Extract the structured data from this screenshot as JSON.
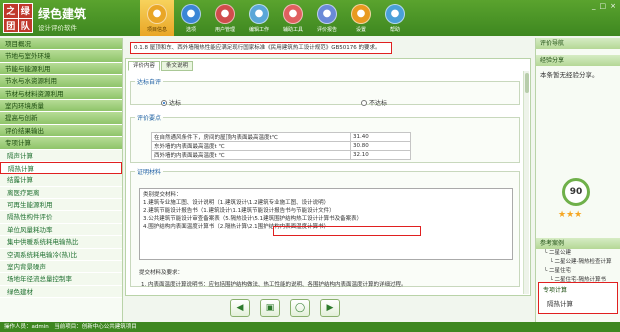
{
  "app": {
    "logo_chars": [
      "之",
      "绿",
      "团",
      "队"
    ],
    "title": "绿色建筑",
    "subtitle": "设计评价软件"
  },
  "nav": [
    {
      "label": "项目信息",
      "icon": "folder-icon",
      "color": "#e9a626",
      "active": true
    },
    {
      "label": "选项",
      "icon": "options-icon",
      "color": "#3b86d6",
      "active": false
    },
    {
      "label": "用户管理",
      "icon": "user-icon",
      "color": "#d04c4c",
      "active": false
    },
    {
      "label": "编辑工作",
      "icon": "edit-icon",
      "color": "#5ba7d8",
      "active": false
    },
    {
      "label": "辅助工具",
      "icon": "tool-icon",
      "color": "#e06060",
      "active": false
    },
    {
      "label": "评价报告",
      "icon": "report-icon",
      "color": "#6a8ad8",
      "active": false
    },
    {
      "label": "设置",
      "icon": "settings-icon",
      "color": "#e89a20",
      "active": false
    },
    {
      "label": "帮助",
      "icon": "help-icon",
      "color": "#4aa0d8",
      "active": false
    }
  ],
  "window_controls": [
    "_",
    "□",
    "×"
  ],
  "sidebar": [
    {
      "label": "项目概况",
      "type": "cat"
    },
    {
      "label": "节地与室外环境",
      "type": "cat"
    },
    {
      "label": "节能与能源利用",
      "type": "cat"
    },
    {
      "label": "节水与水资源利用",
      "type": "cat"
    },
    {
      "label": "节材与材料资源利用",
      "type": "cat"
    },
    {
      "label": "室内环境质量",
      "type": "cat"
    },
    {
      "label": "提高与创新",
      "type": "cat"
    },
    {
      "label": "评价结果输出",
      "type": "cat"
    },
    {
      "label": "专项计算",
      "type": "cat"
    },
    {
      "label": "隔声计算",
      "type": "sub"
    },
    {
      "label": "隔热计算",
      "type": "sub",
      "selected": true
    },
    {
      "label": "结露计算",
      "type": "sub"
    },
    {
      "label": "离医疗距离",
      "type": "sub"
    },
    {
      "label": "可再生能源利用",
      "type": "sub"
    },
    {
      "label": "隔热性构件评价",
      "type": "sub"
    },
    {
      "label": "单位风量耗功率",
      "type": "sub"
    },
    {
      "label": "集中供暖系统耗电输热比",
      "type": "sub"
    },
    {
      "label": "空调系统耗电输冷(热)比",
      "type": "sub"
    },
    {
      "label": "室内背景噪声",
      "type": "sub"
    },
    {
      "label": "场地年径流总量控制率",
      "type": "sub"
    },
    {
      "label": "绿色建材",
      "type": "sub"
    }
  ],
  "notice": "0.1.8 屋顶和东、西外墙隔热性能应满足现行国家标准《民用建筑热工设计规范》GB50176 的要求。",
  "tabs": [
    {
      "label": "评价内容",
      "active": true
    },
    {
      "label": "条文说明",
      "active": false
    }
  ],
  "compliance": {
    "legend": "达标自评",
    "options": [
      {
        "label": "达标",
        "checked": true
      },
      {
        "label": "不达标",
        "checked": false
      }
    ]
  },
  "indicators": {
    "legend": "评价要点",
    "rows": [
      {
        "label": "在自然通风条件下，房间的屋顶内表面最高温度t℃",
        "value": "31.40"
      },
      {
        "label": "东外墙的内表面最高温度t ℃",
        "value": "30.80"
      },
      {
        "label": "西外墙的内表面最高温度t ℃",
        "value": "32.10"
      }
    ]
  },
  "evidence": {
    "legend": "证明材料",
    "box_lines": [
      "类别提交材料：",
      "1.建筑专业施工图、设计说明（1.建筑设计\\1.2建筑专业施工图、设计说明）",
      "2.建筑节能设计报告书（1.建筑设计\\1.1建筑节能设计报告书与节能设计文件）",
      "3.公共建筑节能设计审查备案表（5.隔热设计\\5.1建筑围护结构热工设计计算书及备案表）",
      "4.围护结构内表面温度计算书（2.隔热计算\\2.1围护结构内表面温度计算书）"
    ],
    "note_title": "提交材料及要求：",
    "note": "1. 内表面温度计算说明书：应包括围护结构做法、热工性能的说明、各围护结构内表面温度计算的详细过程。"
  },
  "bottom_buttons": [
    {
      "icon": "prev-icon",
      "glyph": "◀"
    },
    {
      "icon": "save-icon",
      "glyph": "▣"
    },
    {
      "icon": "refresh-icon",
      "glyph": "◯"
    },
    {
      "icon": "next-icon",
      "glyph": "▶"
    }
  ],
  "right_panel": {
    "header": "评价导航",
    "info_header": "经验分享",
    "info_text": "本条暂无经验分享。",
    "score": "90",
    "stars": "★★★",
    "ref_header": "参考案例",
    "ref_lines": [
      "└ 二星公建",
      "　└ 二星公建-隔热检查计算",
      "└ 二星住宅",
      "　└ 二星住宅-隔热计算书"
    ],
    "related_title": "专项计算",
    "related_item": "隔热计算"
  },
  "status": "操作人员：admin　当前项目：创新中心公共建筑项目"
}
